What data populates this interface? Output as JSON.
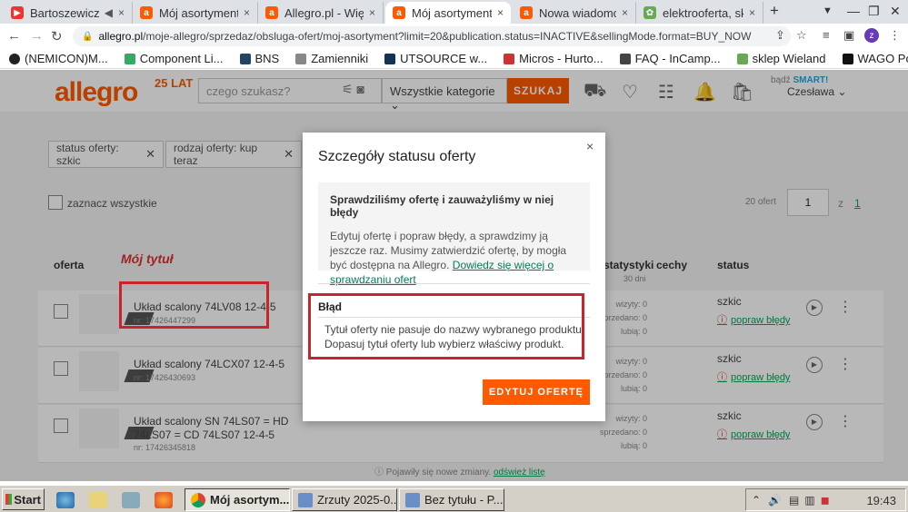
{
  "browser": {
    "tabs": [
      {
        "title": "Bartoszewicz –",
        "favicon_color": "#e33"
      },
      {
        "title": "Mój asortyment -",
        "favicon_color": "#ff5a00"
      },
      {
        "title": "Allegro.pl - Więce",
        "favicon_color": "#ff5a00"
      },
      {
        "title": "Mój asortyment -",
        "favicon_color": "#ff5a00"
      },
      {
        "title": "Nowa wiadomość",
        "favicon_color": "#ff5a00"
      },
      {
        "title": "elektrooferta, skle",
        "favicon_color": "#6a5"
      }
    ],
    "new_tab_glyph": "+",
    "tab_close_glyph": "×",
    "url_host": "allegro.pl",
    "url_path": "/moje-allegro/sprzedaz/obsluga-ofert/moj-asortyment?limit=20&publication.status=INACTIVE&sellingMode.format=BUY_NOW",
    "profile_letter": "z",
    "bookmarks": [
      {
        "label": "(NEMICON)M...",
        "color": "#222"
      },
      {
        "label": "Component Li...",
        "color": "#3a6"
      },
      {
        "label": "BNS",
        "color": "#246"
      },
      {
        "label": "Zamienniki",
        "color": "#888"
      },
      {
        "label": "UTSOURCE w...",
        "color": "#135"
      },
      {
        "label": "Micros - Hurto...",
        "color": "#c33"
      },
      {
        "label": "FAQ - InCamp...",
        "color": "#444"
      },
      {
        "label": "sklep Wieland",
        "color": "#6a5"
      },
      {
        "label": "WAGO Polska",
        "color": "#111"
      }
    ]
  },
  "header": {
    "logo": "allegro",
    "logo_badge": "25 LAT",
    "search_placeholder": "czego szukasz?",
    "category": "Wszystkie kategorie",
    "search_button": "SZUKAJ",
    "smart_label": "bądź",
    "smart_brand": "SMART!",
    "user_name": "Czesława"
  },
  "filters": {
    "chips": [
      "status oferty: szkic",
      "rodzaj oferty: kup teraz"
    ],
    "select_all": "zaznacz wszystkie",
    "per_page": "20 ofert",
    "page_current": "1",
    "page_of": "z",
    "page_total": "1"
  },
  "columns": {
    "offer": "oferta",
    "statistics": "statystyki",
    "statistics_sub": "30 dni",
    "features": "cechy",
    "status": "status"
  },
  "annotation": "Mój tytuł",
  "offers": [
    {
      "title": "Układ scalony 74LV08 12-4-5",
      "nr": "nr: 17426447299",
      "stats": [
        "wizyty: 0",
        "sprzedano: 0",
        "lubią: 0"
      ],
      "status": "szkic",
      "fix": "popraw błędy"
    },
    {
      "title": "Układ scalony 74LCX07 12-4-5",
      "nr": "nr: 17426430693",
      "stats": [
        "wizyty: 0",
        "sprzedano: 0",
        "lubią: 0"
      ],
      "status": "szkic",
      "fix": "popraw błędy"
    },
    {
      "title": "Układ scalony SN 74LS07 = HD 74LS07 = CD 74LS07 12-4-5",
      "nr": "nr: 17426345818",
      "stats": [
        "wizyty: 0",
        "sprzedano: 0",
        "lubią: 0"
      ],
      "status": "szkic",
      "fix": "popraw błędy"
    }
  ],
  "changes_note": "Pojawiły się nowe zmiany.",
  "changes_link": "odśwież listę",
  "modal": {
    "title": "Szczegóły statusu oferty",
    "info_heading": "Sprawdziliśmy ofertę i zauważyliśmy w niej błędy",
    "info_text": "Edytuj ofertę i popraw błędy, a sprawdzimy ją jeszcze raz. Musimy zatwierdzić ofertę, by mogła być dostępna na Allegro.",
    "info_link": "Dowiedz się więcej o sprawdzaniu ofert",
    "error_heading": "Błąd",
    "error_text": "Tytuł oferty nie pasuje do nazwy wybranego produktu. Dopasuj tytuł oferty lub wybierz właściwy produkt.",
    "edit_button": "EDYTUJ OFERTĘ",
    "close_glyph": "×"
  },
  "taskbar": {
    "start": "Start",
    "tasks": [
      {
        "label": "Mój asortym...",
        "active": true,
        "color": "#4285f4"
      },
      {
        "label": "Zrzuty 2025-0...",
        "active": false,
        "color": "#6a8fc8"
      },
      {
        "label": "Bez tytułu - P...",
        "active": false,
        "color": "#6a8fc8"
      }
    ],
    "clock": "19:43"
  }
}
